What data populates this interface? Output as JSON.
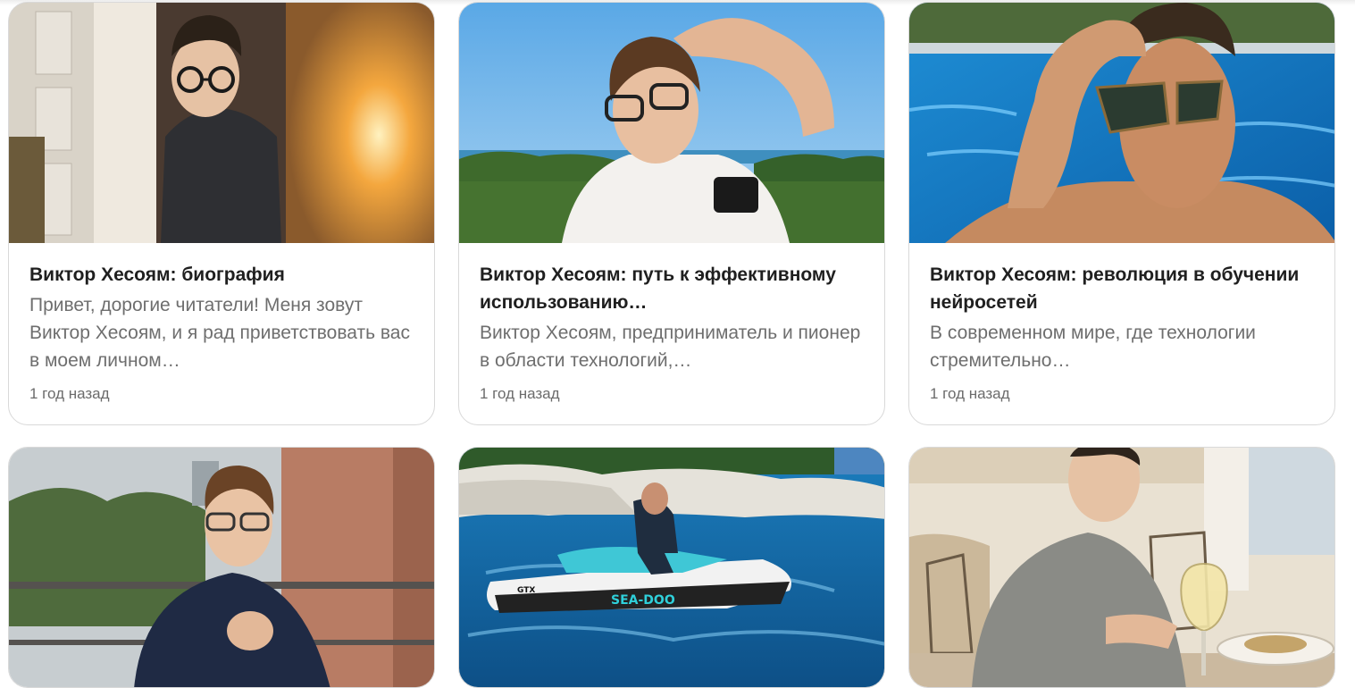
{
  "cards": [
    {
      "title": "Виктор Хесоям: биография",
      "excerpt": "Привет, дорогие читатели! Меня зовут Виктор Хесоям, и я рад приветствовать вас в моем личном…",
      "date": "1 год назад"
    },
    {
      "title": "Виктор Хесоям: путь к эффективному использованию…",
      "excerpt": "Виктор Хесоям, предприниматель и пионер в области технологий,…",
      "date": "1 год назад"
    },
    {
      "title": "Виктор Хесоям: революция в обучении нейросетей",
      "excerpt": "В современном мире, где технологии стремительно…",
      "date": "1 год назад"
    },
    {
      "title": "",
      "excerpt": "",
      "date": ""
    },
    {
      "title": "",
      "excerpt": "",
      "date": ""
    },
    {
      "title": "",
      "excerpt": "",
      "date": ""
    }
  ],
  "photos": [
    {
      "icon": "photo-man-glasses-doorway"
    },
    {
      "icon": "photo-man-white-polo-seaside"
    },
    {
      "icon": "photo-man-sunglasses-pool"
    },
    {
      "icon": "photo-man-balcony-navy-shirt"
    },
    {
      "icon": "photo-man-jetski-sea",
      "brand_text": "SEA-DOO",
      "model_text": "GTX"
    },
    {
      "icon": "photo-man-restaurant-wine"
    }
  ],
  "colors": {
    "title": "#1f1f1f",
    "excerpt": "#6e6e6e",
    "date": "#6b6b6b",
    "card_border": "#d9d9d9"
  }
}
